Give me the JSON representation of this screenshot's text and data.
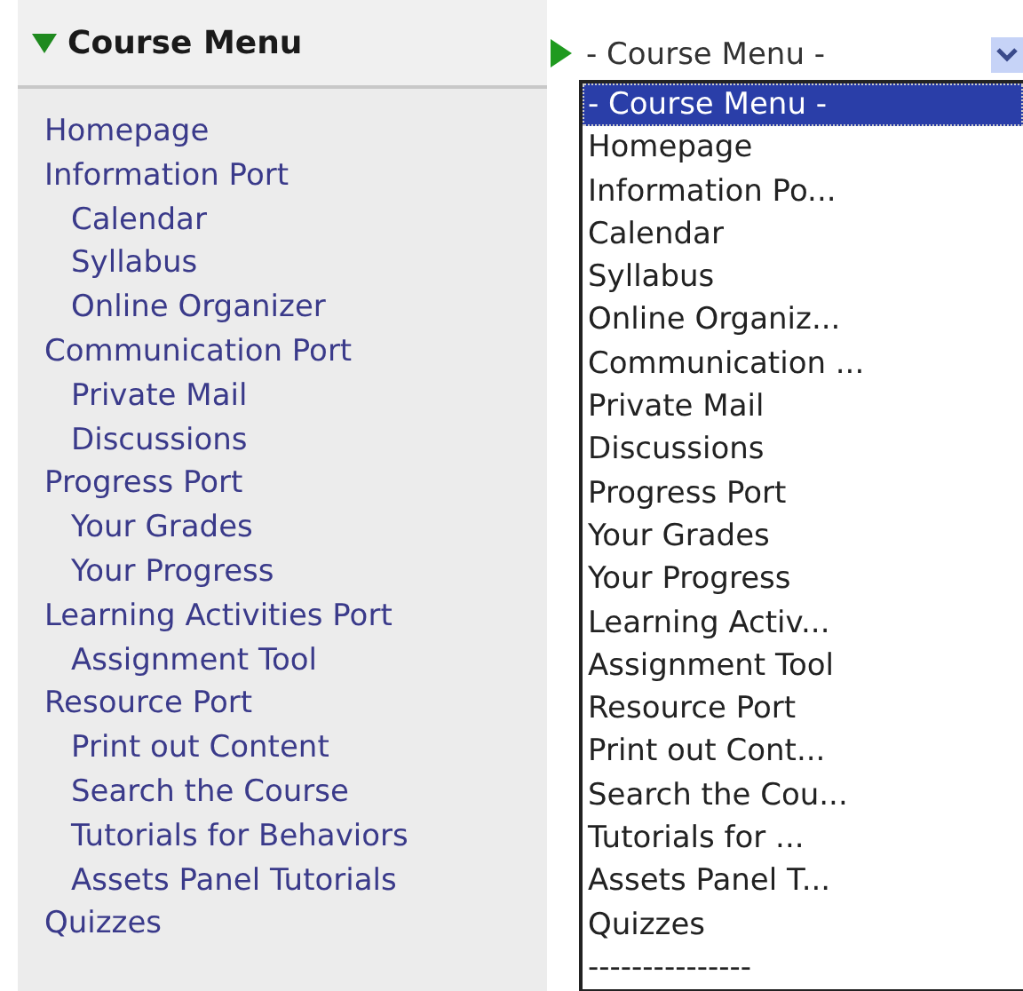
{
  "sidebar": {
    "title": "Course Menu",
    "expanded": true,
    "items": [
      {
        "label": "Homepage"
      },
      {
        "label": "Information Port",
        "children": [
          {
            "label": "Calendar"
          },
          {
            "label": "Syllabus"
          },
          {
            "label": "Online Organizer"
          }
        ]
      },
      {
        "label": "Communication Port",
        "children": [
          {
            "label": "Private Mail"
          },
          {
            "label": "Discussions"
          }
        ]
      },
      {
        "label": "Progress Port",
        "children": [
          {
            "label": "Your Grades"
          },
          {
            "label": "Your Progress"
          }
        ]
      },
      {
        "label": "Learning Activities Port",
        "children": [
          {
            "label": "Assignment Tool"
          }
        ]
      },
      {
        "label": "Resource Port",
        "children": [
          {
            "label": "Print out Content"
          },
          {
            "label": "Search the Course"
          },
          {
            "label": "Tutorials for Behaviors"
          },
          {
            "label": "Assets Panel Tutorials"
          }
        ]
      },
      {
        "label": "Quizzes"
      }
    ]
  },
  "dropdown": {
    "value": "- Course Menu -",
    "open": true,
    "options": [
      {
        "label": "- Course Menu -",
        "selected": true
      },
      {
        "label": "Homepage",
        "selected": false
      },
      {
        "label": "Information Po...",
        "selected": false
      },
      {
        "label": "Calendar",
        "selected": false
      },
      {
        "label": "Syllabus",
        "selected": false
      },
      {
        "label": "Online Organiz...",
        "selected": false
      },
      {
        "label": "Communication ...",
        "selected": false
      },
      {
        "label": "Private Mail",
        "selected": false
      },
      {
        "label": "Discussions",
        "selected": false
      },
      {
        "label": "Progress Port",
        "selected": false
      },
      {
        "label": "Your Grades",
        "selected": false
      },
      {
        "label": "Your Progress",
        "selected": false
      },
      {
        "label": "Learning Activ...",
        "selected": false
      },
      {
        "label": "Assignment Tool",
        "selected": false
      },
      {
        "label": "Resource Port",
        "selected": false
      },
      {
        "label": "Print out Cont...",
        "selected": false
      },
      {
        "label": "Search the Cou...",
        "selected": false
      },
      {
        "label": "Tutorials for ...",
        "selected": false
      },
      {
        "label": "Assets Panel T...",
        "selected": false
      },
      {
        "label": "Quizzes",
        "selected": false
      },
      {
        "label": "---------------",
        "selected": false
      }
    ]
  }
}
